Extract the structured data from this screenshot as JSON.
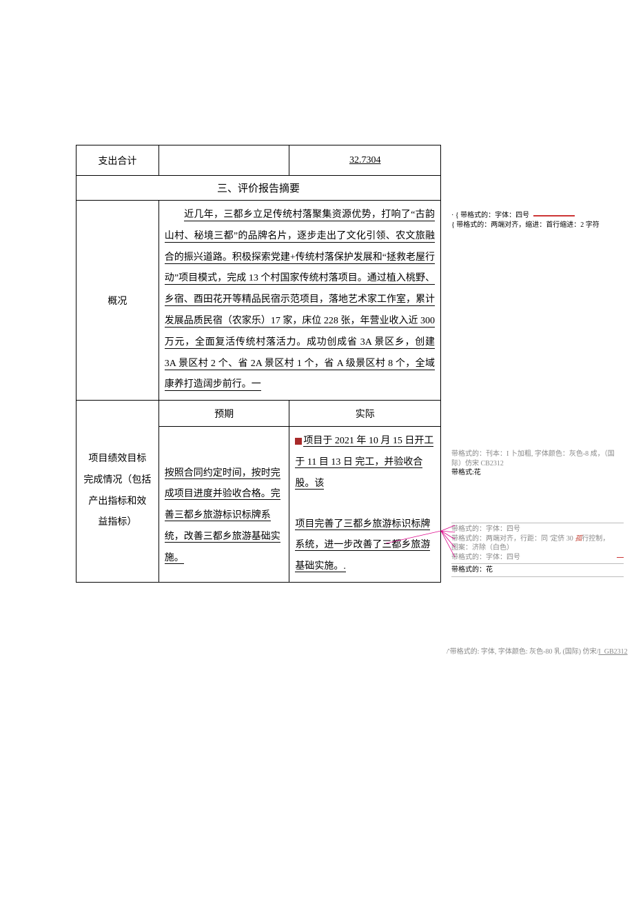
{
  "row_total": {
    "label": "支出合计",
    "value": "32.7304"
  },
  "section3_title": "三、评价报告摘要",
  "overview": {
    "label": "概况",
    "text": "近几年，三都乡立足传统村落聚集资源优势，打响了“古韵山村、秘境三都”的品牌名片，逐步走出了文化引领、农文旅融合的振兴道路。积极探索党建+传统村落保护发展和“拯救老屋行动”项目模式，完成 13 个村国家传统村落项目。通过植入桃野、乡宿、酉田花开等精品民宿示范项目，落地艺术家工作室，累计发展品质民宿（农家乐）17 家，床位 228 张，年营业收入近 300 万元，全面复活传统村落活力。成功创成省 3A 景区乡，创建 3A 景区村 2 个、省 2A 景区村 1 个，省 A 级景区村 8 个，全域康养打造阔步前行。一"
  },
  "targets": {
    "label_lines": [
      "项目绩效目标",
      "完成情况（包括",
      "产出指标和效",
      "益指标）"
    ],
    "col_expect": "预期",
    "col_actual": "实际",
    "expect_text": "按照合同约定时间，按时完成项目进度并验收合格。完善三都乡旅游标识标牌系统，改善三都乡旅游基础实施。",
    "actual_text_pre": "项目于 2021 年 10 月 15 日开工于 11 目 13 日 完工，并验收合股。该",
    "actual_text_post": "项目完善了三都乡旅游标识标牌系统，进一步改善了三都乡旅游基础实施。."
  },
  "notes": {
    "n1a": "{ 带格式的：字体：四号",
    "n1b": "{ 带格式的：两端对齐，缩进：首行缩进：2 字符",
    "n2": "带格式的：刊本：I 卜加粗, 字体颜色：灰色-8 成，（国际）仿宋 CB2312",
    "n2b": "带格式:花",
    "n3a": "带格式的：字体：四号",
    "n3b_a": "带格式的：两端对齐，行距：同 '定侪 30 ",
    "n3b_word": "孤",
    "n3b_b": "行控制，",
    "n3c": "图案：济除（白色）",
    "n3d": "带格式的：字体：四号",
    "n3d_strike": "—",
    "n3e": "带格式的：花",
    "n4_pre": "/'带格式的: 字体, 字体颜色: 灰色-80 乳 (国际) 仿宋/",
    "n4_link": "I_GB2312"
  }
}
